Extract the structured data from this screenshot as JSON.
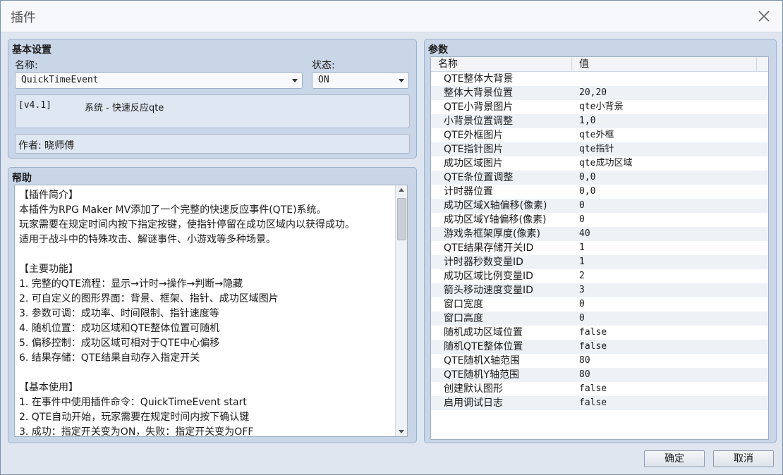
{
  "window": {
    "title": "插件"
  },
  "basic": {
    "section_title": "基本设置",
    "name_label": "名称:",
    "name_value": "QuickTimeEvent",
    "status_label": "状态:",
    "status_value": "ON",
    "version": "[v4.1]",
    "description": "系统 - 快速反应qte",
    "author": "作者: 晓师傅"
  },
  "help": {
    "section_title": "帮助",
    "lines": [
      "【插件简介】",
      "本插件为RPG Maker MV添加了一个完整的快速反应事件(QTE)系统。",
      "玩家需要在规定时间内按下指定按键，使指针停留在成功区域内以获得成功。",
      "适用于战斗中的特殊攻击、解谜事件、小游戏等多种场景。",
      "",
      "【主要功能】",
      "1. 完整的QTE流程：显示→计时→操作→判断→隐藏",
      "2. 可自定义的图形界面：背景、框架、指针、成功区域图片",
      "3. 参数可调：成功率、时间限制、指针速度等",
      "4. 随机位置：成功区域和QTE整体位置可随机",
      "5. 偏移控制：成功区域可相对于QTE中心偏移",
      "6. 结果存储：QTE结果自动存入指定开关",
      "",
      "【基本使用】",
      "1. 在事件中使用插件命令：QuickTimeEvent start",
      "2. QTE自动开始，玩家需要在规定时间内按下确认键",
      "3. 成功：指定开关变为ON，失败：指定开关变为OFF"
    ]
  },
  "params": {
    "section_title": "参数",
    "col_name": "名称",
    "col_value": "值",
    "rows": [
      {
        "name": "QTE整体大背景",
        "value": ""
      },
      {
        "name": "整体大背景位置",
        "value": "20,20"
      },
      {
        "name": "QTE小背景图片",
        "value": "qte小背景"
      },
      {
        "name": "小背景位置调整",
        "value": "1,0"
      },
      {
        "name": "QTE外框图片",
        "value": "qte外框"
      },
      {
        "name": "QTE指针图片",
        "value": "qte指针"
      },
      {
        "name": "成功区域图片",
        "value": "qte成功区域"
      },
      {
        "name": "QTE条位置调整",
        "value": "0,0"
      },
      {
        "name": "计时器位置",
        "value": "0,0"
      },
      {
        "name": "成功区域X轴偏移(像素)",
        "value": "0"
      },
      {
        "name": "成功区域Y轴偏移(像素)",
        "value": "0"
      },
      {
        "name": "游戏条框架厚度(像素)",
        "value": "40"
      },
      {
        "name": "QTE结果存储开关ID",
        "value": "1"
      },
      {
        "name": "计时器秒数变量ID",
        "value": "1"
      },
      {
        "name": "成功区域比例变量ID",
        "value": "2"
      },
      {
        "name": "箭头移动速度变量ID",
        "value": "3"
      },
      {
        "name": "窗口宽度",
        "value": "0"
      },
      {
        "name": "窗口高度",
        "value": "0"
      },
      {
        "name": "随机成功区域位置",
        "value": "false"
      },
      {
        "name": "随机QTE整体位置",
        "value": "false"
      },
      {
        "name": "QTE随机X轴范围",
        "value": "80"
      },
      {
        "name": "QTE随机Y轴范围",
        "value": "80"
      },
      {
        "name": "创建默认图形",
        "value": "false"
      },
      {
        "name": "启用调试日志",
        "value": "false"
      }
    ]
  },
  "footer": {
    "ok_label": "确定",
    "cancel_label": "取消"
  }
}
